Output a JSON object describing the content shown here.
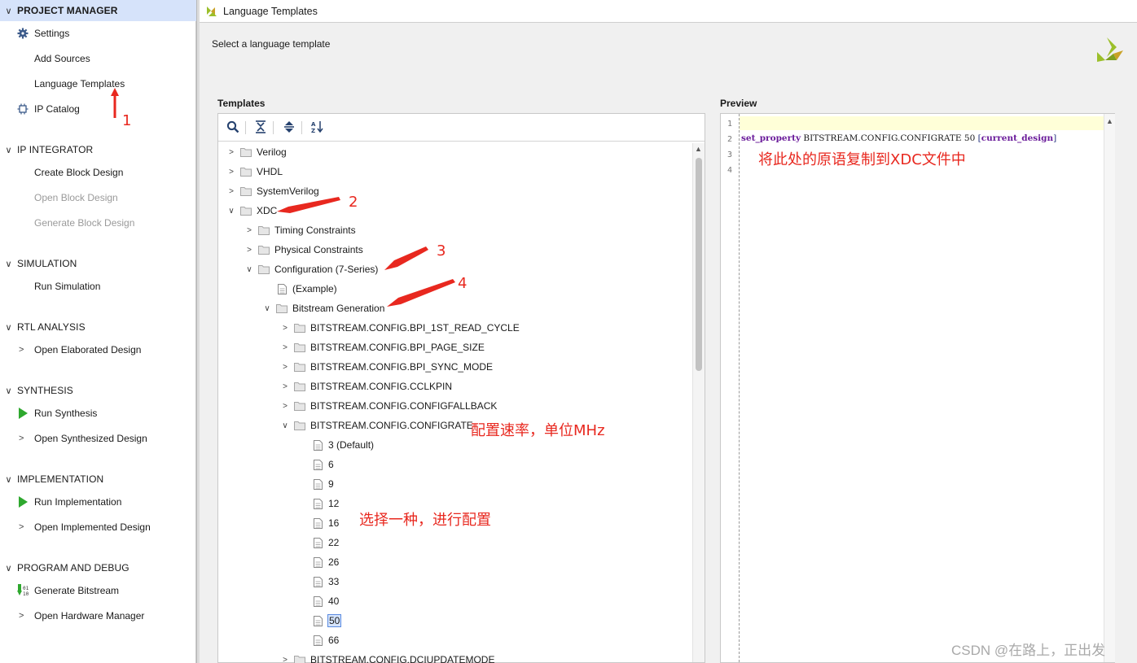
{
  "flow_navigator": {
    "sections": [
      {
        "id": "project-manager",
        "title": "PROJECT MANAGER",
        "selected": true,
        "items": [
          {
            "label": "Settings",
            "icon": "gear-icon"
          },
          {
            "label": "Add Sources"
          },
          {
            "label": "Language Templates"
          },
          {
            "label": "IP Catalog",
            "icon": "ip-chip-icon"
          }
        ]
      },
      {
        "id": "ip-integrator",
        "title": "IP INTEGRATOR",
        "items": [
          {
            "label": "Create Block Design"
          },
          {
            "label": "Open Block Design",
            "disabled": true
          },
          {
            "label": "Generate Block Design",
            "disabled": true
          }
        ]
      },
      {
        "id": "simulation",
        "title": "SIMULATION",
        "items": [
          {
            "label": "Run Simulation"
          }
        ]
      },
      {
        "id": "rtl-analysis",
        "title": "RTL ANALYSIS",
        "items": [
          {
            "label": "Open Elaborated Design",
            "expandable": true
          }
        ]
      },
      {
        "id": "synthesis",
        "title": "SYNTHESIS",
        "items": [
          {
            "label": "Run Synthesis",
            "icon": "play-icon"
          },
          {
            "label": "Open Synthesized Design",
            "expandable": true
          }
        ]
      },
      {
        "id": "implementation",
        "title": "IMPLEMENTATION",
        "items": [
          {
            "label": "Run Implementation",
            "icon": "play-icon"
          },
          {
            "label": "Open Implemented Design",
            "expandable": true
          }
        ]
      },
      {
        "id": "program-debug",
        "title": "PROGRAM AND DEBUG",
        "items": [
          {
            "label": "Generate Bitstream",
            "icon": "bitstream-icon"
          },
          {
            "label": "Open Hardware Manager",
            "expandable": true
          }
        ]
      }
    ]
  },
  "window": {
    "title": "Language Templates",
    "subtitle": "Select a language template"
  },
  "templates": {
    "label": "Templates",
    "tree": [
      {
        "label": "Verilog",
        "level": 0,
        "state": "collapsed",
        "kind": "folder"
      },
      {
        "label": "VHDL",
        "level": 0,
        "state": "collapsed",
        "kind": "folder"
      },
      {
        "label": "SystemVerilog",
        "level": 0,
        "state": "collapsed",
        "kind": "folder"
      },
      {
        "label": "XDC",
        "level": 0,
        "state": "expanded",
        "kind": "folder"
      },
      {
        "label": "Timing Constraints",
        "level": 1,
        "state": "collapsed",
        "kind": "folder"
      },
      {
        "label": "Physical Constraints",
        "level": 1,
        "state": "collapsed",
        "kind": "folder"
      },
      {
        "label": "Configuration (7-Series)",
        "level": 1,
        "state": "expanded",
        "kind": "folder"
      },
      {
        "label": "(Example)",
        "level": 2,
        "state": "leaf",
        "kind": "file"
      },
      {
        "label": "Bitstream Generation",
        "level": 2,
        "state": "expanded",
        "kind": "folder"
      },
      {
        "label": "BITSTREAM.CONFIG.BPI_1ST_READ_CYCLE",
        "level": 3,
        "state": "collapsed",
        "kind": "folder"
      },
      {
        "label": "BITSTREAM.CONFIG.BPI_PAGE_SIZE",
        "level": 3,
        "state": "collapsed",
        "kind": "folder"
      },
      {
        "label": "BITSTREAM.CONFIG.BPI_SYNC_MODE",
        "level": 3,
        "state": "collapsed",
        "kind": "folder"
      },
      {
        "label": "BITSTREAM.CONFIG.CCLKPIN",
        "level": 3,
        "state": "collapsed",
        "kind": "folder"
      },
      {
        "label": "BITSTREAM.CONFIG.CONFIGFALLBACK",
        "level": 3,
        "state": "collapsed",
        "kind": "folder"
      },
      {
        "label": "BITSTREAM.CONFIG.CONFIGRATE",
        "level": 3,
        "state": "expanded",
        "kind": "folder"
      },
      {
        "label": "3 (Default)",
        "level": 4,
        "state": "leaf",
        "kind": "file"
      },
      {
        "label": "6",
        "level": 4,
        "state": "leaf",
        "kind": "file"
      },
      {
        "label": "9",
        "level": 4,
        "state": "leaf",
        "kind": "file"
      },
      {
        "label": "12",
        "level": 4,
        "state": "leaf",
        "kind": "file"
      },
      {
        "label": "16",
        "level": 4,
        "state": "leaf",
        "kind": "file"
      },
      {
        "label": "22",
        "level": 4,
        "state": "leaf",
        "kind": "file"
      },
      {
        "label": "26",
        "level": 4,
        "state": "leaf",
        "kind": "file"
      },
      {
        "label": "33",
        "level": 4,
        "state": "leaf",
        "kind": "file"
      },
      {
        "label": "40",
        "level": 4,
        "state": "leaf",
        "kind": "file"
      },
      {
        "label": "50",
        "level": 4,
        "state": "leaf",
        "kind": "file",
        "selected": true
      },
      {
        "label": "66",
        "level": 4,
        "state": "leaf",
        "kind": "file"
      },
      {
        "label": "BITSTREAM.CONFIG.DCIUPDATEMODE",
        "level": 3,
        "state": "collapsed",
        "kind": "folder"
      }
    ]
  },
  "preview": {
    "label": "Preview",
    "line_numbers": [
      "1",
      "2",
      "3",
      "4"
    ],
    "code_keyword": "set_property",
    "code_middle": " BITSTREAM.CONFIG.CONFIGRATE 50 ",
    "code_bracket_open": "[",
    "code_command": "current_design",
    "code_bracket_close": "]"
  },
  "annotations": {
    "n1": "1",
    "n2": "2",
    "n3": "3",
    "n4": "4",
    "copy_note": "将此处的原语复制到XDC文件中",
    "rate_note": "配置速率，单位MHz",
    "choose_note": "选择一种，进行配置",
    "color": "#e8281f"
  },
  "watermark": "CSDN @在路上，正出发",
  "colors": {
    "selected_section_bg": "#d6e3fa",
    "current_line_bg": "#ffffd8",
    "play_green": "#2ea82e",
    "logo_green": "#9bbf2a"
  }
}
